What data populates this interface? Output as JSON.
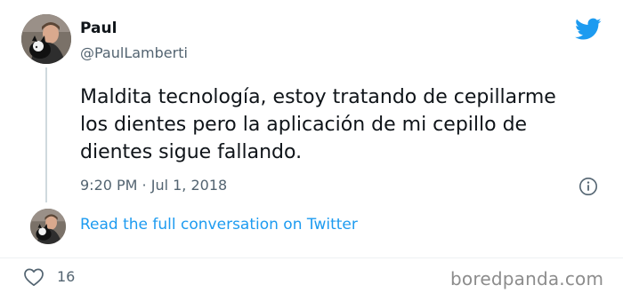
{
  "author": {
    "display_name": "Paul",
    "handle": "@PaulLamberti",
    "avatar_icon": "profile-photo-man-with-cat"
  },
  "tweet": {
    "lines": [
      "Maldita tecnología, estoy tratando de cepillarme",
      "los dientes pero la aplicación de mi cepillo de",
      "dientes sigue fallando."
    ],
    "timestamp": "9:20 PM · Jul 1, 2018"
  },
  "conversation_link": "Read the full conversation on Twitter",
  "engagement": {
    "likes": "16",
    "like_icon": "heart-outline-icon"
  },
  "icons": {
    "brand": "twitter-bird-icon",
    "info": "info-circle-icon"
  },
  "watermark": "boredpanda.com",
  "colors": {
    "accent": "#1d9bf0",
    "text_primary": "#0f1419",
    "text_secondary": "#536471",
    "divider": "#eef1f3",
    "watermark": "#8c8c8c"
  }
}
